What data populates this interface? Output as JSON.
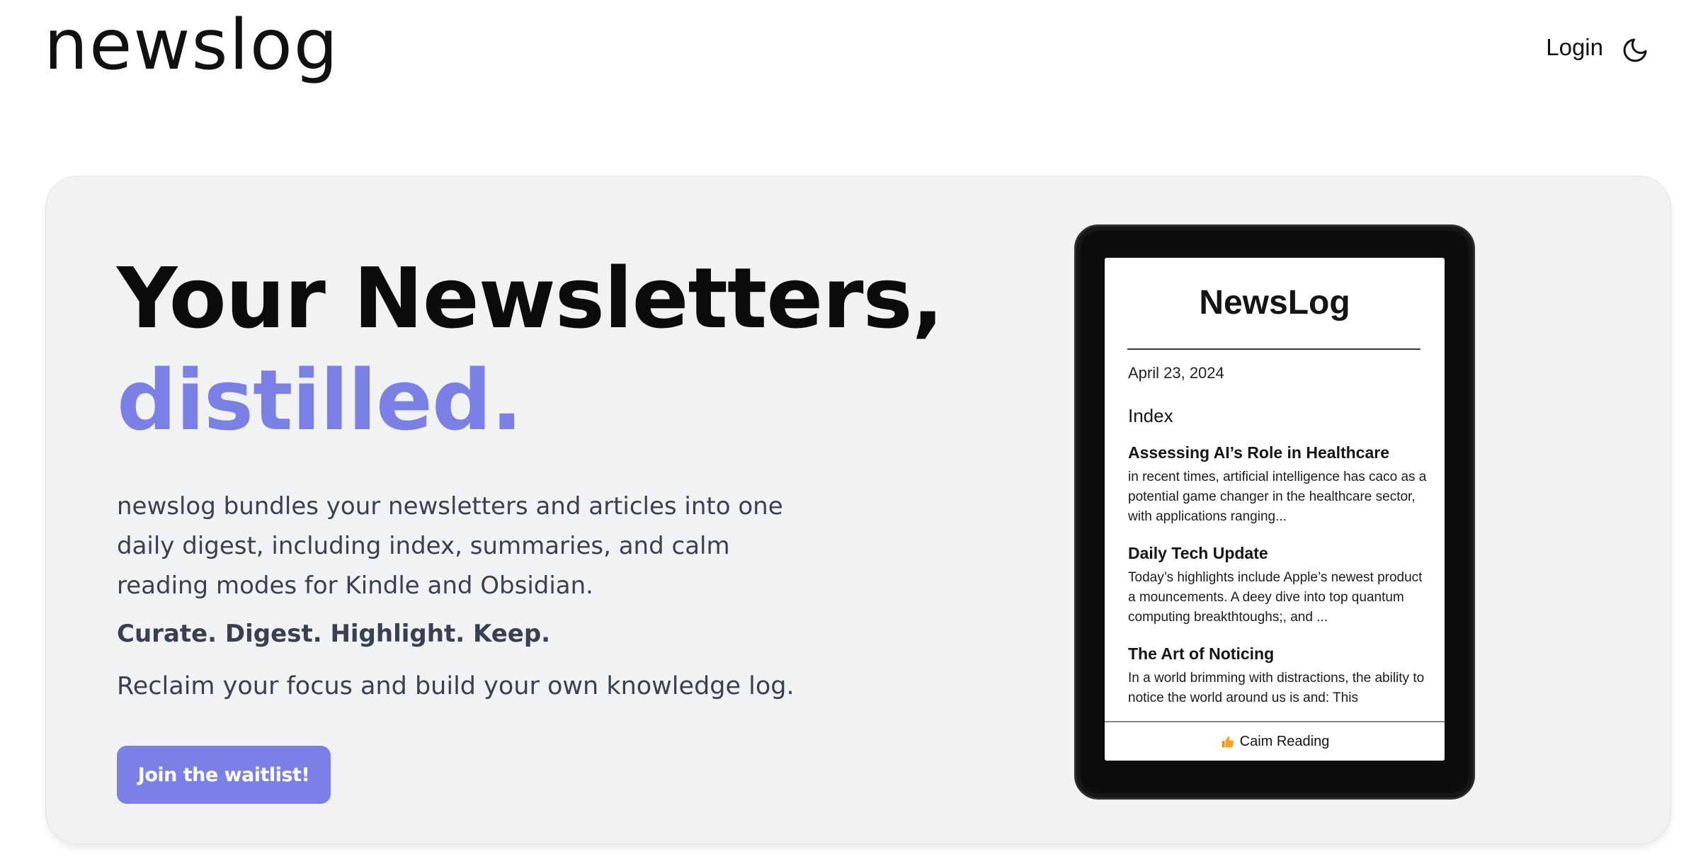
{
  "header": {
    "logo": "newslog",
    "login_label": "Login",
    "theme_icon": "moon-icon"
  },
  "hero": {
    "headline_line1": "Your Newsletters,",
    "headline_line2": "distilled.",
    "description": "newslog bundles your newsletters and articles into one daily digest, including index, summaries, and calm reading modes for Kindle and Obsidian.",
    "tagline": "Curate. Digest. Highlight. Keep.",
    "reclaim": "Reclaim your focus and build your own knowledge log.",
    "cta_label": "Join the waitlist!"
  },
  "device": {
    "title": "NewsLog",
    "date": "April 23, 2024",
    "index_label": "Index",
    "articles": [
      {
        "title": "Assessing AI’s Role in Healthcare",
        "body": "in recent times, artificial intelligence has caco as a potential game changer in the healthcare sector, with applications ranging..."
      },
      {
        "title": "Daily Tech Update",
        "body": "Today’s highlights include Apple’s newest product a mouncements.  A deey dive into top quantum computing breakthtoughs;, and  ..."
      },
      {
        "title": "The Art of Noticing",
        "body": "In a world brimming with distractions, the ability to notice the world around us is and:  This"
      }
    ],
    "calm_label": "Caim Reading",
    "calm_icon": "thumbs-up-icon"
  },
  "colors": {
    "accent": "#7b80e6",
    "hero_bg": "#f1f2f4",
    "body_text": "#374151",
    "device_frame": "#0c0d0d"
  }
}
